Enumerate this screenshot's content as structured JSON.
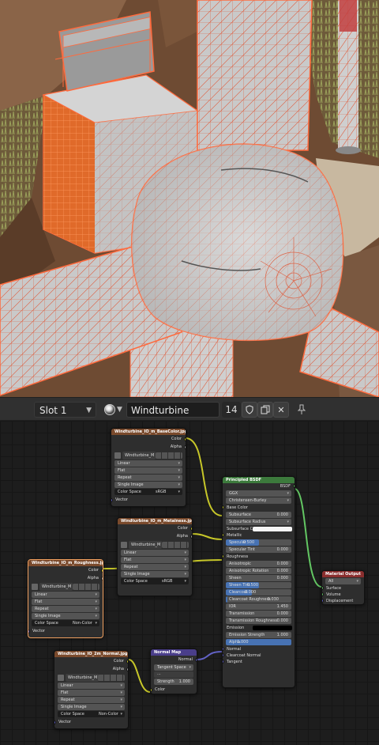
{
  "header": {
    "slot": "Slot 1",
    "material_name": "Windturbine",
    "user_count": "14",
    "icons": [
      "material-ball-icon",
      "chevron-down-icon",
      "fake-user-shield-icon",
      "duplicate-icon",
      "close-icon",
      "pin-icon"
    ]
  },
  "nodes": {
    "base_color": {
      "title": "Windturbine_IO_m_BaseColor.jpg",
      "out_color": "Color",
      "out_alpha": "Alpha",
      "image": "Windturbine_M",
      "interp": "Linear",
      "proj": "Flat",
      "ext": "Repeat",
      "source": "Single Image",
      "cs_label": "Color Space",
      "cs_value": "sRGB",
      "in_vector": "Vector"
    },
    "roughness_hidden": {
      "title": "Windturbine_IO_m_Roughness.jpg",
      "out_color": "Color",
      "out_alpha": "Alpha",
      "image": "Windturbine_M",
      "interp": "Linear",
      "proj": "Flat",
      "ext": "Repeat",
      "source": "Single Image",
      "cs_label": "Color Space",
      "cs_value": "Non-Color",
      "in_vector": "Vector"
    },
    "metallic": {
      "title": "Windturbine_IO_m_Metalness.jpg",
      "out_color": "Color",
      "out_alpha": "Alpha",
      "image": "Windturbine_M",
      "interp": "Linear",
      "proj": "Flat",
      "ext": "Repeat",
      "source": "Single Image",
      "cs_label": "Color Space",
      "cs_value": "sRGB",
      "in_vector": "Vector"
    },
    "normal_image": {
      "title": "Windturbine_IO_2m_Normal.jpg",
      "out_color": "Color",
      "out_alpha": "Alpha",
      "image": "Windturbine_M",
      "interp": "Linear",
      "proj": "Flat",
      "ext": "Repeat",
      "source": "Single Image",
      "cs_label": "Color Space",
      "cs_value": "Non-Color",
      "in_vector": "Vector"
    },
    "normal_map": {
      "title": "Normal Map",
      "out_normal": "Normal",
      "space": "Tangent Space",
      "strength_label": "Strength",
      "strength": "1.000",
      "in_color": "Color"
    },
    "bsdf": {
      "title": "Principled BSDF",
      "out": "BSDF",
      "dist": "GGX",
      "sss_method": "Christensen-Burley",
      "base_color": "Base Color",
      "subsurface": "Subsurface",
      "subsurface_v": "0.000",
      "subsurface_radius": "Subsurface Radius",
      "subsurface_color": "Subsurface Co...",
      "metallic": "Metallic",
      "specular": "Specular",
      "specular_v": "0.500",
      "specular_tint": "Specular Tint",
      "specular_tint_v": "0.000",
      "roughness": "Roughness",
      "anisotropic": "Anisotropic",
      "anisotropic_v": "0.000",
      "aniso_rot": "Anisotropic Rotation",
      "aniso_rot_v": "0.000",
      "sheen": "Sheen",
      "sheen_v": "0.000",
      "sheen_tint": "Sheen Tint",
      "sheen_tint_v": "0.500",
      "clearcoat": "Clearcoat",
      "clearcoat_v": "0.000",
      "cc_rough": "Clearcoat Roughness",
      "cc_rough_v": "0.030",
      "ior": "IOR",
      "ior_v": "1.450",
      "transmission": "Transmission",
      "transmission_v": "0.000",
      "trans_rough": "Transmission Roughness",
      "trans_rough_v": "0.000",
      "emission": "Emission",
      "emission_strength": "Emission Strength",
      "emission_strength_v": "1.000",
      "alpha": "Alpha",
      "alpha_v": "1.000",
      "normal": "Normal",
      "cc_normal": "Clearcoat Normal",
      "tangent": "Tangent"
    },
    "output": {
      "title": "Material Output",
      "target": "All",
      "surface": "Surface",
      "volume": "Volume",
      "displacement": "Displacement"
    }
  },
  "slider_levels": {
    "specular": 0.5,
    "sheen_tint": 0.5,
    "clearcoat_roughness": 0.03,
    "alpha": 1.0
  },
  "colors": {
    "image_header": "#7a4a2c",
    "bsdf_header": "#3c7a3c",
    "vector_header": "#4a3e8a",
    "output_header": "#8a2e2e",
    "wire_orange": "#ff6a3d",
    "socket_color": "#c7c729",
    "socket_float": "#a1a1a1",
    "socket_vector": "#6363c7",
    "socket_shader": "#63c763"
  }
}
